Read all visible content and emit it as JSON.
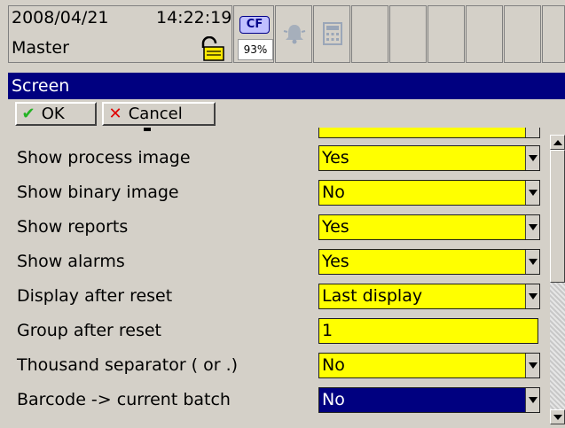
{
  "status": {
    "date": "2008/04/21",
    "time": "14:22:19",
    "user_mode": "Master",
    "cf_label": "CF",
    "cf_percent": "93%"
  },
  "icons": {
    "lock": "padlock-open-icon",
    "alarm": "alarm-bell-icon",
    "calculator": "calculator-icon"
  },
  "title": "Screen",
  "toolbar": {
    "ok_label": "OK",
    "cancel_label": "Cancel"
  },
  "rows": [
    {
      "label": "Show process image",
      "value": "Yes"
    },
    {
      "label": "Show binary image",
      "value": "No"
    },
    {
      "label": "Show reports",
      "value": "Yes"
    },
    {
      "label": "Show alarms",
      "value": "Yes"
    },
    {
      "label": "Display after reset",
      "value": "Last display"
    },
    {
      "label": "Group after reset",
      "value": "1"
    },
    {
      "label": "Thousand separator ( or .)",
      "value": "No"
    },
    {
      "label": "Barcode -> current batch",
      "value": "No"
    }
  ],
  "colors": {
    "field": "#ffff00",
    "selected_field": "#000080",
    "titlebar": "#000080",
    "ok_icon": "#24b324",
    "cancel_icon": "#e00000"
  }
}
